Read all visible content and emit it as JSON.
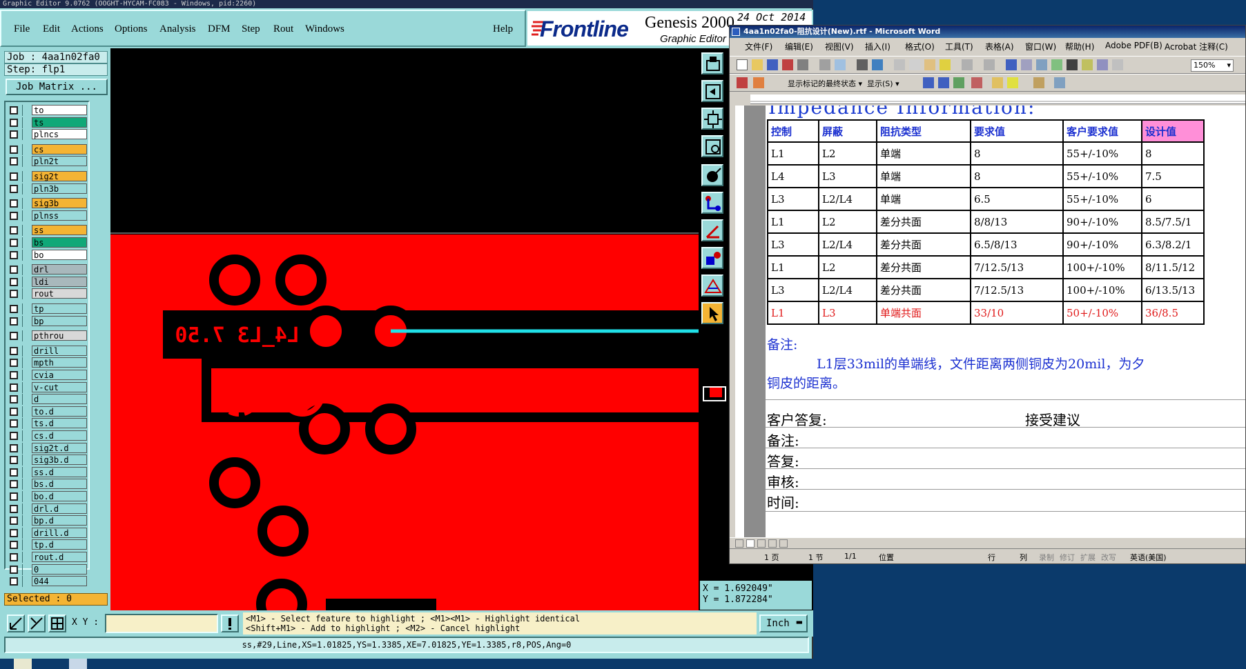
{
  "genesis": {
    "title": "Graphic Editor 9.0762 (OOGHT-HYCAM-FC083 - Windows, pid:2260)",
    "menu": [
      "File",
      "Edit",
      "Actions",
      "Options",
      "Analysis",
      "DFM",
      "Step",
      "Rout",
      "Windows"
    ],
    "help": "Help",
    "brand": "Frontline",
    "product": "Genesis 2000",
    "product_sub": "Graphic Editor",
    "date": "24 Oct 2014",
    "job": "Job : 4aa1n02fa0",
    "step": "Step: flp1",
    "job_matrix": "Job Matrix ...",
    "layers": [
      {
        "name": "to",
        "color": "#ffffff"
      },
      {
        "name": "ts",
        "color": "#10a878"
      },
      {
        "name": "plncs",
        "color": "#ffffff"
      },
      {
        "name": "cs",
        "color": "#f4b434"
      },
      {
        "name": "pln2t",
        "color": "#9ad9d9"
      },
      {
        "name": "sig2t",
        "color": "#f4b434"
      },
      {
        "name": "pln3b",
        "color": "#9ad9d9"
      },
      {
        "name": "sig3b",
        "color": "#f4b434"
      },
      {
        "name": "plnss",
        "color": "#9ad9d9"
      },
      {
        "name": "ss",
        "color": "#f4b434"
      },
      {
        "name": "bs",
        "color": "#10a878"
      },
      {
        "name": "bo",
        "color": "#ffffff"
      },
      {
        "name": "drl",
        "color": "#a8b8bc"
      },
      {
        "name": "ldi",
        "color": "#a8b8bc"
      },
      {
        "name": "rout",
        "color": "#d8d8d8"
      },
      {
        "name": "tp",
        "color": "#9ad9d9"
      },
      {
        "name": "bp",
        "color": "#9ad9d9"
      },
      {
        "name": "pthrou",
        "color": "#d8d8d8"
      },
      {
        "name": "drill",
        "color": "#9ad9d9"
      },
      {
        "name": "mpth",
        "color": "#9ad9d9"
      },
      {
        "name": "cvia",
        "color": "#9ad9d9"
      },
      {
        "name": "v-cut",
        "color": "#9ad9d9"
      },
      {
        "name": "d",
        "color": "#9ad9d9"
      },
      {
        "name": "to.d",
        "color": "#9ad9d9"
      },
      {
        "name": "ts.d",
        "color": "#9ad9d9"
      },
      {
        "name": "cs.d",
        "color": "#9ad9d9"
      },
      {
        "name": "sig2t.d",
        "color": "#9ad9d9"
      },
      {
        "name": "sig3b.d",
        "color": "#9ad9d9"
      },
      {
        "name": "ss.d",
        "color": "#9ad9d9"
      },
      {
        "name": "bs.d",
        "color": "#9ad9d9"
      },
      {
        "name": "bo.d",
        "color": "#9ad9d9"
      },
      {
        "name": "drl.d",
        "color": "#9ad9d9"
      },
      {
        "name": "bp.d",
        "color": "#9ad9d9"
      },
      {
        "name": "drill.d",
        "color": "#9ad9d9"
      },
      {
        "name": "tp.d",
        "color": "#9ad9d9"
      },
      {
        "name": "rout.d",
        "color": "#9ad9d9"
      },
      {
        "name": "0",
        "color": "#9ad9d9"
      },
      {
        "name": "044",
        "color": "#9ad9d9"
      }
    ],
    "selected": "Selected : 0",
    "canvas_label": "L4_L3 7.50 *",
    "coord_x": "X = 1.692049\"",
    "coord_y": "Y = 1.872284\"",
    "xy_label": "X Y :",
    "hint_line1": "<M1> - Select feature to highlight ; <M1><M1> - Highlight identical",
    "hint_line2": "<Shift+M1> - Add to highlight ; <M2> - Cancel highlight",
    "units": "Inch",
    "status": "ss,#29,Line,XS=1.01825,YS=1.3385,XE=7.01825,YE=1.3385,r8,POS,Ang=0",
    "colors": {
      "copper": "#ff0000",
      "trace_highlight": "#20e0e8",
      "panel": "#9ad9d9"
    }
  },
  "word": {
    "title": "4aa1n02fa0-阻抗设计(New).rtf - Microsoft Word",
    "menu": [
      "文件(F)",
      "编辑(E)",
      "视图(V)",
      "插入(I)",
      "格式(O)",
      "工具(T)",
      "表格(A)",
      "窗口(W)",
      "帮助(H)",
      "Adobe PDF(B)",
      "Acrobat 注释(C)"
    ],
    "zoom": "150%",
    "review_text": "显示标记的最终状态",
    "show_text": "显示(S)",
    "heading": "Impedance  Information:",
    "table_headers": [
      "控制",
      "屏蔽",
      "阻抗类型",
      "要求值",
      "客户要求值",
      "设计值"
    ],
    "table_rows": [
      [
        "L1",
        "L2",
        "单端",
        "8",
        "55+/-10%",
        "8"
      ],
      [
        "L4",
        "L3",
        "单端",
        "8",
        "55+/-10%",
        "7.5"
      ],
      [
        "L3",
        "L2/L4",
        "单端",
        "6.5",
        "55+/-10%",
        "6"
      ],
      [
        "L1",
        "L2",
        "差分共面",
        "8/8/13",
        "90+/-10%",
        "8.5/7.5/1"
      ],
      [
        "L3",
        "L2/L4",
        "差分共面",
        "6.5/8/13",
        "90+/-10%",
        "6.3/8.2/1"
      ],
      [
        "L1",
        "L2",
        "差分共面",
        "7/12.5/13",
        "100+/-10%",
        "8/11.5/12"
      ],
      [
        "L3",
        "L2/L4",
        "差分共面",
        "7/12.5/13",
        "100+/-10%",
        "6/13.5/13"
      ],
      [
        "L1",
        "L3",
        "单端共面",
        "33/10",
        "50+/-10%",
        "36/8.5"
      ]
    ],
    "note_label": "备注:",
    "note_text": "L1层33mil的单端线，文件距离两侧铜皮为20mil，为夕",
    "note_text2": "铜皮的距离。",
    "reply_label": "客户答复:",
    "reply_value": "接受建议",
    "form_labels": [
      "备注:",
      "答复:",
      "审核:",
      "时间:"
    ],
    "status": {
      "page": "1 页",
      "section": "1 节",
      "pages": "1/1",
      "position": "位置",
      "line": "行",
      "col": "列",
      "rec": "录制",
      "trk": "修订",
      "ext": "扩展",
      "ovr": "改写",
      "lang": "英语(美国)"
    }
  }
}
